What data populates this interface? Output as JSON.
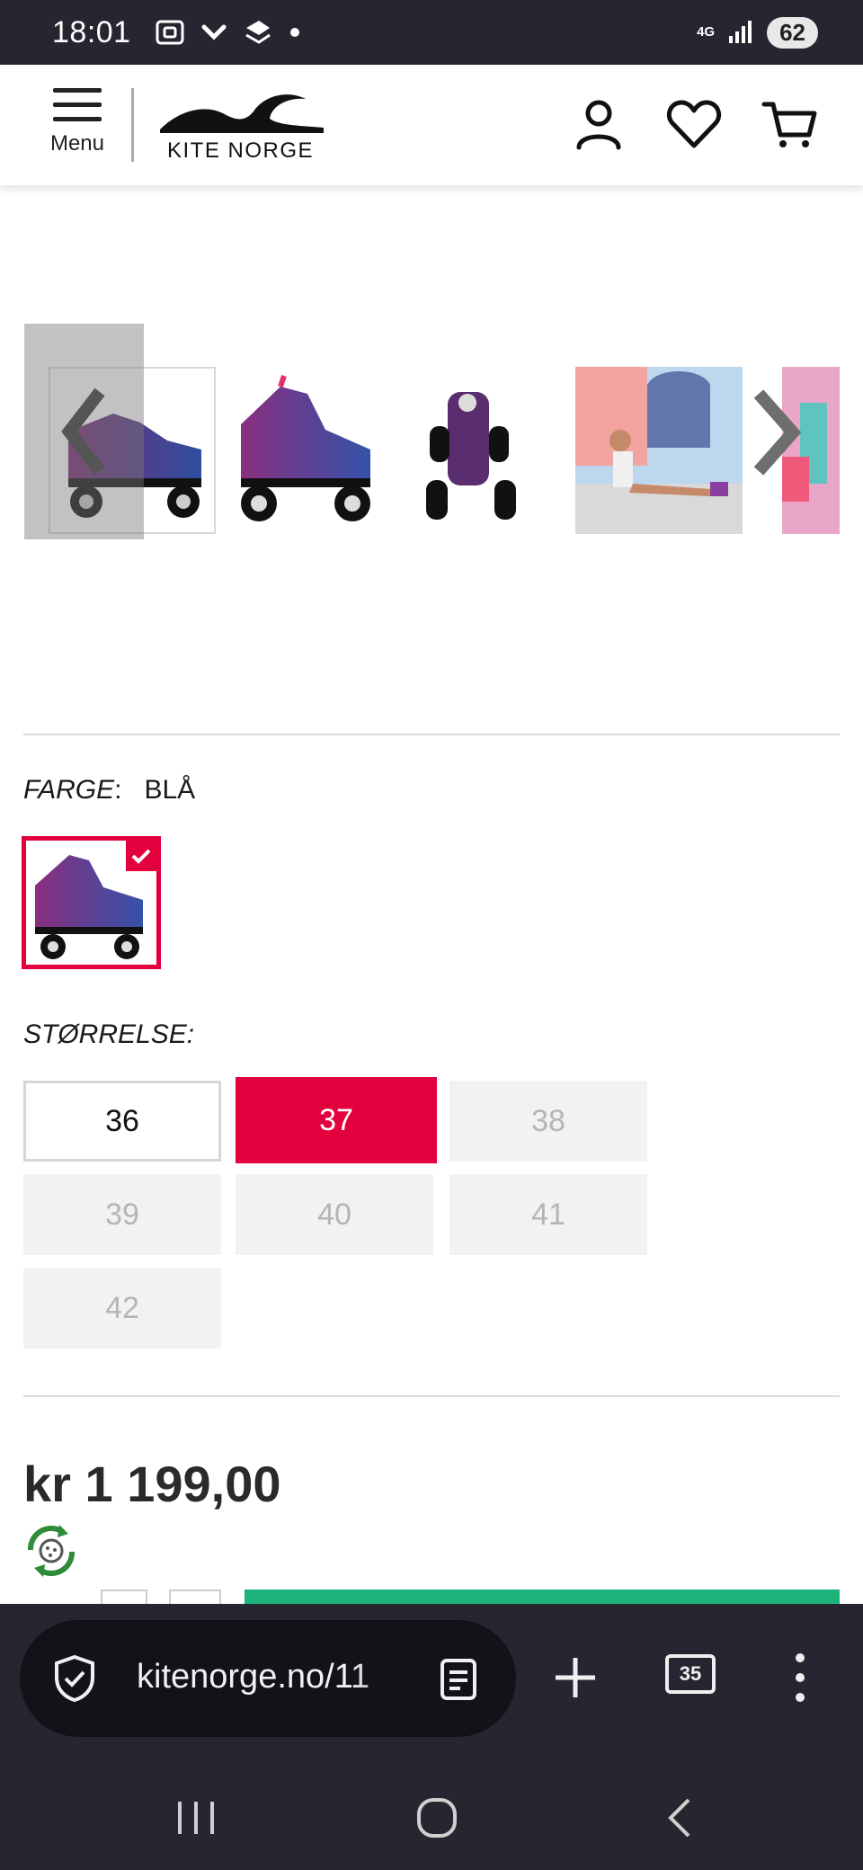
{
  "status": {
    "time": "18:01",
    "network": "4G",
    "battery": "62"
  },
  "header": {
    "menu_label": "Menu",
    "logo_text": "KITE  NORGE"
  },
  "variant": {
    "color_key": "FARGE",
    "color_value": "BLÅ"
  },
  "sizes": {
    "label": "STØRRELSE",
    "options": [
      {
        "label": "36",
        "state": "available"
      },
      {
        "label": "37",
        "state": "selected"
      },
      {
        "label": "38",
        "state": "unavailable"
      },
      {
        "label": "39",
        "state": "unavailable"
      },
      {
        "label": "40",
        "state": "unavailable"
      },
      {
        "label": "41",
        "state": "unavailable"
      },
      {
        "label": "42",
        "state": "unavailable"
      }
    ]
  },
  "price": "kr 1 199,00",
  "browser": {
    "url": "kitenorge.no/11",
    "tab_count": "35"
  },
  "colors": {
    "accent": "#e2003d",
    "cta": "#1db37a",
    "chrome": "#262630"
  }
}
